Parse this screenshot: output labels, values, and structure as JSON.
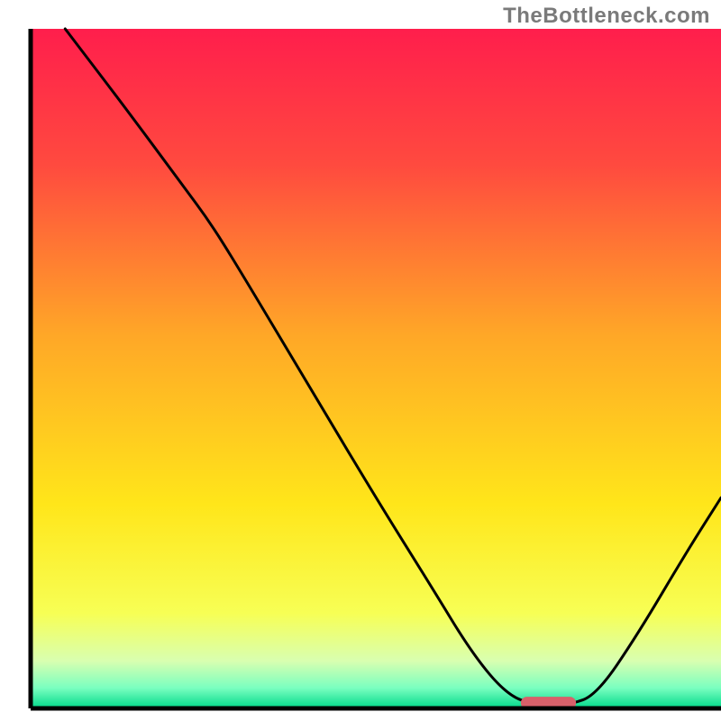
{
  "watermark": "TheBottleneck.com",
  "chart_data": {
    "type": "line",
    "title": "",
    "xlabel": "",
    "ylabel": "",
    "xlim": [
      0,
      100
    ],
    "ylim": [
      0,
      100
    ],
    "axes": {
      "left": true,
      "bottom": true,
      "top": false,
      "right": false,
      "ticks_visible": false,
      "grid": false
    },
    "background_gradient": {
      "type": "vertical",
      "stops": [
        {
          "offset": 0.0,
          "color": "#ff1e4c"
        },
        {
          "offset": 0.2,
          "color": "#ff4a3f"
        },
        {
          "offset": 0.45,
          "color": "#ffa727"
        },
        {
          "offset": 0.7,
          "color": "#ffe61a"
        },
        {
          "offset": 0.86,
          "color": "#f7ff55"
        },
        {
          "offset": 0.93,
          "color": "#d9ffb0"
        },
        {
          "offset": 0.97,
          "color": "#7affc0"
        },
        {
          "offset": 1.0,
          "color": "#00d98a"
        }
      ]
    },
    "series": [
      {
        "name": "bottleneck-curve",
        "color": "#000000",
        "stroke_width": 3,
        "points": [
          {
            "x": 5.0,
            "y": 100.0
          },
          {
            "x": 14.0,
            "y": 88.0
          },
          {
            "x": 22.0,
            "y": 77.0
          },
          {
            "x": 26.0,
            "y": 71.5
          },
          {
            "x": 30.0,
            "y": 65.0
          },
          {
            "x": 40.0,
            "y": 48.0
          },
          {
            "x": 50.0,
            "y": 31.0
          },
          {
            "x": 58.0,
            "y": 18.0
          },
          {
            "x": 64.0,
            "y": 8.0
          },
          {
            "x": 69.0,
            "y": 2.0
          },
          {
            "x": 73.0,
            "y": 0.5
          },
          {
            "x": 78.0,
            "y": 0.5
          },
          {
            "x": 82.0,
            "y": 2.0
          },
          {
            "x": 88.0,
            "y": 11.0
          },
          {
            "x": 95.0,
            "y": 23.0
          },
          {
            "x": 100.0,
            "y": 31.0
          }
        ]
      }
    ],
    "marker": {
      "name": "optimal-marker",
      "shape": "rounded-rect",
      "color": "#d9606a",
      "x_center": 75.0,
      "y_center": 0.8,
      "width": 8.0,
      "height": 1.8
    }
  }
}
